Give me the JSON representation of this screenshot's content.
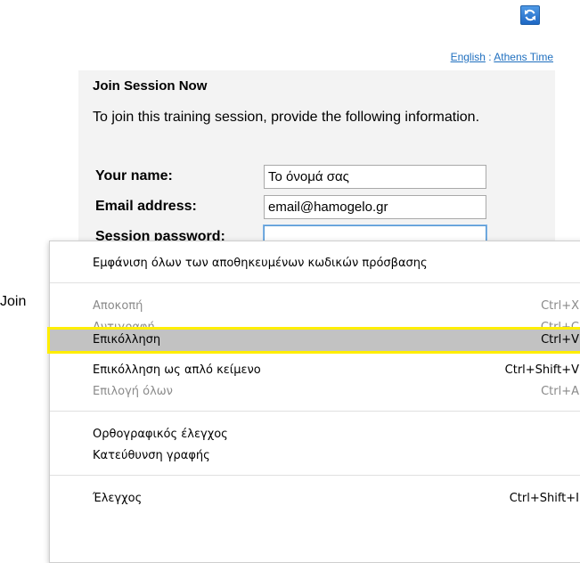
{
  "header": {
    "language_link": "English",
    "separator": ":",
    "timezone_link": "Athens Time"
  },
  "join": {
    "title": "Join Session Now",
    "intro": "To join this training session, provide the following information.",
    "fields": [
      {
        "label": "Your name:",
        "value": "Το όνομά σας"
      },
      {
        "label": "Email address:",
        "value": "email@hamogelo.gr"
      },
      {
        "label": "Session password:",
        "value": ""
      }
    ],
    "behind_button_text": "Join"
  },
  "context_menu": {
    "show_passwords": "Εμφάνιση όλων των αποθηκευμένων κωδικών πρόσβασης",
    "cut": {
      "label": "Αποκοπή",
      "shortcut": "Ctrl+X"
    },
    "copy": {
      "label": "Αντιγραφή",
      "shortcut": "Ctrl+C"
    },
    "paste": {
      "label": "Επικόλληση",
      "shortcut": "Ctrl+V"
    },
    "paste_plain": {
      "label": "Επικόλληση ως απλό κείμενο",
      "shortcut": "Ctrl+Shift+V"
    },
    "select_all": {
      "label": "Επιλογή όλων",
      "shortcut": "Ctrl+A"
    },
    "spellcheck": "Ορθογραφικός έλεγχος",
    "writing_direction": "Κατεύθυνση γραφής",
    "inspect": {
      "label": "Έλεγχος",
      "shortcut": "Ctrl+Shift+I"
    }
  },
  "colors": {
    "link": "#1f6fbf",
    "highlight_outline": "#ffee00",
    "highlight_bg": "#c2c2c2"
  }
}
